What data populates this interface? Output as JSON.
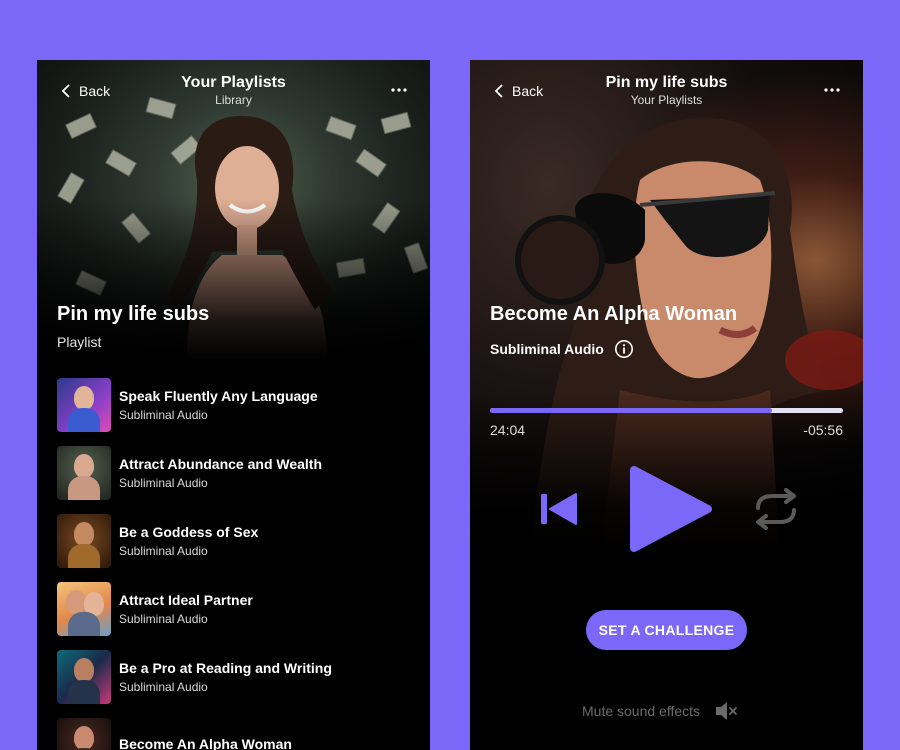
{
  "left": {
    "nav": {
      "back_label": "Back",
      "title": "Your Playlists",
      "subtitle": "Library"
    },
    "hero": {
      "title": "Pin my life subs",
      "subtitle": "Playlist"
    },
    "tracks": [
      {
        "name": "Speak Fluently Any Language",
        "kind": "Subliminal Audio"
      },
      {
        "name": "Attract Abundance and Wealth",
        "kind": "Subliminal Audio"
      },
      {
        "name": "Be a Goddess of Sex",
        "kind": "Subliminal Audio"
      },
      {
        "name": "Attract Ideal Partner",
        "kind": "Subliminal Audio"
      },
      {
        "name": "Be a Pro at Reading and Writing",
        "kind": "Subliminal Audio"
      },
      {
        "name": "Become An Alpha Woman",
        "kind": ""
      }
    ]
  },
  "right": {
    "nav": {
      "back_label": "Back",
      "title": "Pin my life subs",
      "subtitle": "Your Playlists"
    },
    "song": {
      "title": "Become An Alpha Woman",
      "subtitle": "Subliminal Audio"
    },
    "player": {
      "elapsed": "24:04",
      "remaining": "-05:56",
      "progress": 0.8
    },
    "challenge_label": "SET A CHALLENGE",
    "mute_label": "Mute sound effects"
  },
  "colors": {
    "accent": "#7b68f8",
    "background": "#7b68f8",
    "panel": "#000000",
    "muted_text": "#6b6b6b"
  },
  "icons": [
    "chevron-left-icon",
    "more-icon",
    "info-icon",
    "skip-previous-icon",
    "play-icon",
    "repeat-icon",
    "mute-speaker-icon"
  ]
}
